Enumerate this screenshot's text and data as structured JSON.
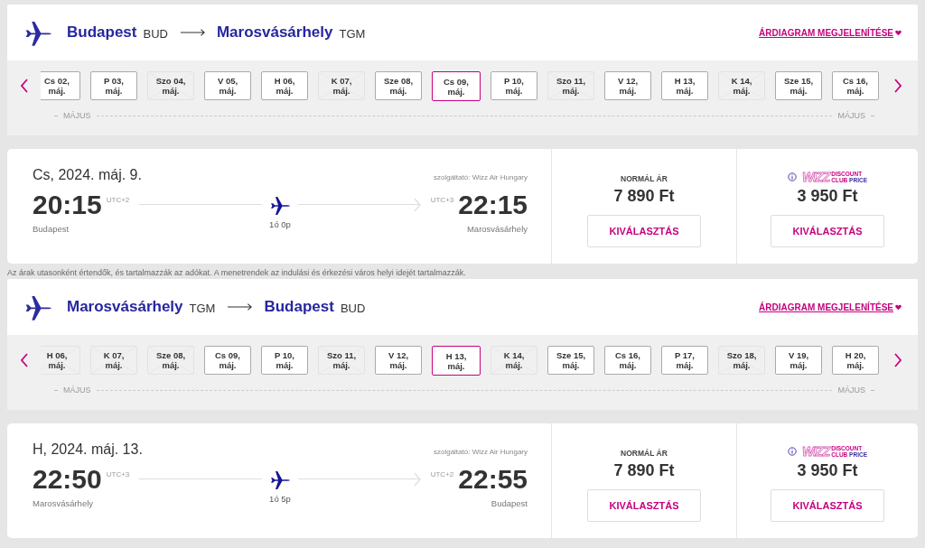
{
  "legs": [
    {
      "route": {
        "from_city": "Budapest",
        "from_code": "BUD",
        "to_city": "Marosvásárhely",
        "to_code": "TGM"
      },
      "price_chart_link": "ÁRDIAGRAM MEGJELENÍTÉSE",
      "dates": [
        {
          "day": "Cs 02,",
          "month": "máj.",
          "available": true,
          "selected": false
        },
        {
          "day": "P 03,",
          "month": "máj.",
          "available": true,
          "selected": false
        },
        {
          "day": "Szo 04,",
          "month": "máj.",
          "available": false,
          "selected": false
        },
        {
          "day": "V 05,",
          "month": "máj.",
          "available": true,
          "selected": false
        },
        {
          "day": "H 06,",
          "month": "máj.",
          "available": true,
          "selected": false
        },
        {
          "day": "K 07,",
          "month": "máj.",
          "available": false,
          "selected": false
        },
        {
          "day": "Sze 08,",
          "month": "máj.",
          "available": true,
          "selected": false
        },
        {
          "day": "Cs 09,",
          "month": "máj.",
          "available": true,
          "selected": true
        },
        {
          "day": "P 10,",
          "month": "máj.",
          "available": true,
          "selected": false
        },
        {
          "day": "Szo 11,",
          "month": "máj.",
          "available": false,
          "selected": false
        },
        {
          "day": "V 12,",
          "month": "máj.",
          "available": true,
          "selected": false
        },
        {
          "day": "H 13,",
          "month": "máj.",
          "available": true,
          "selected": false
        },
        {
          "day": "K 14,",
          "month": "máj.",
          "available": false,
          "selected": false
        },
        {
          "day": "Sze 15,",
          "month": "máj.",
          "available": true,
          "selected": false
        },
        {
          "day": "Cs 16,",
          "month": "máj.",
          "available": true,
          "selected": false
        }
      ],
      "month_labels": [
        "MÁJUS",
        "MÁJUS"
      ],
      "flight": {
        "date": "Cs, 2024. máj. 9.",
        "operator": "szolgáltató: Wizz Air Hungary",
        "departure_time": "20:15",
        "departure_tz": "UTC+2",
        "departure_city": "Budapest",
        "duration": "1ó 0p",
        "arrival_tz": "UTC+3",
        "arrival_time": "22:15",
        "arrival_city": "Marosvásárhely"
      },
      "fares": [
        {
          "kind": "normal",
          "label": "NORMÁL ÁR",
          "price": "7 890 Ft",
          "button": "KIVÁLASZTÁS"
        },
        {
          "kind": "discount_club",
          "logo": {
            "brand": "WIZZ",
            "line1": "DISCOUNT",
            "line2a": "CLUB",
            "line2b": "PRICE"
          },
          "price": "3 950 Ft",
          "button": "KIVÁLASZTÁS"
        }
      ]
    },
    {
      "route": {
        "from_city": "Marosvásárhely",
        "from_code": "TGM",
        "to_city": "Budapest",
        "to_code": "BUD"
      },
      "price_chart_link": "ÁRDIAGRAM MEGJELENÍTÉSE",
      "dates": [
        {
          "day": "H 06,",
          "month": "máj.",
          "available": false,
          "selected": false
        },
        {
          "day": "K 07,",
          "month": "máj.",
          "available": false,
          "selected": false
        },
        {
          "day": "Sze 08,",
          "month": "máj.",
          "available": false,
          "selected": false
        },
        {
          "day": "Cs 09,",
          "month": "máj.",
          "available": true,
          "selected": false
        },
        {
          "day": "P 10,",
          "month": "máj.",
          "available": true,
          "selected": false
        },
        {
          "day": "Szo 11,",
          "month": "máj.",
          "available": false,
          "selected": false
        },
        {
          "day": "V 12,",
          "month": "máj.",
          "available": true,
          "selected": false
        },
        {
          "day": "H 13,",
          "month": "máj.",
          "available": true,
          "selected": true
        },
        {
          "day": "K 14,",
          "month": "máj.",
          "available": false,
          "selected": false
        },
        {
          "day": "Sze 15,",
          "month": "máj.",
          "available": true,
          "selected": false
        },
        {
          "day": "Cs 16,",
          "month": "máj.",
          "available": true,
          "selected": false
        },
        {
          "day": "P 17,",
          "month": "máj.",
          "available": true,
          "selected": false
        },
        {
          "day": "Szo 18,",
          "month": "máj.",
          "available": false,
          "selected": false
        },
        {
          "day": "V 19,",
          "month": "máj.",
          "available": true,
          "selected": false
        },
        {
          "day": "H 20,",
          "month": "máj.",
          "available": true,
          "selected": false
        }
      ],
      "month_labels": [
        "MÁJUS",
        "MÁJUS"
      ],
      "flight": {
        "date": "H, 2024. máj. 13.",
        "operator": "szolgáltató: Wizz Air Hungary",
        "departure_time": "22:50",
        "departure_tz": "UTC+3",
        "departure_city": "Marosvásárhely",
        "duration": "1ó 5p",
        "arrival_tz": "UTC+2",
        "arrival_time": "22:55",
        "arrival_city": "Budapest"
      },
      "fares": [
        {
          "kind": "normal",
          "label": "NORMÁL ÁR",
          "price": "7 890 Ft",
          "button": "KIVÁLASZTÁS"
        },
        {
          "kind": "discount_club",
          "logo": {
            "brand": "WIZZ",
            "line1": "DISCOUNT",
            "line2a": "CLUB",
            "line2b": "PRICE"
          },
          "price": "3 950 Ft",
          "button": "KIVÁLASZTÁS"
        }
      ]
    }
  ],
  "note": "Az árak utasonként értendők, és tartalmazzák az adókat. A menetrendek az indulási és érkezési város helyi idejét tartalmazzák."
}
